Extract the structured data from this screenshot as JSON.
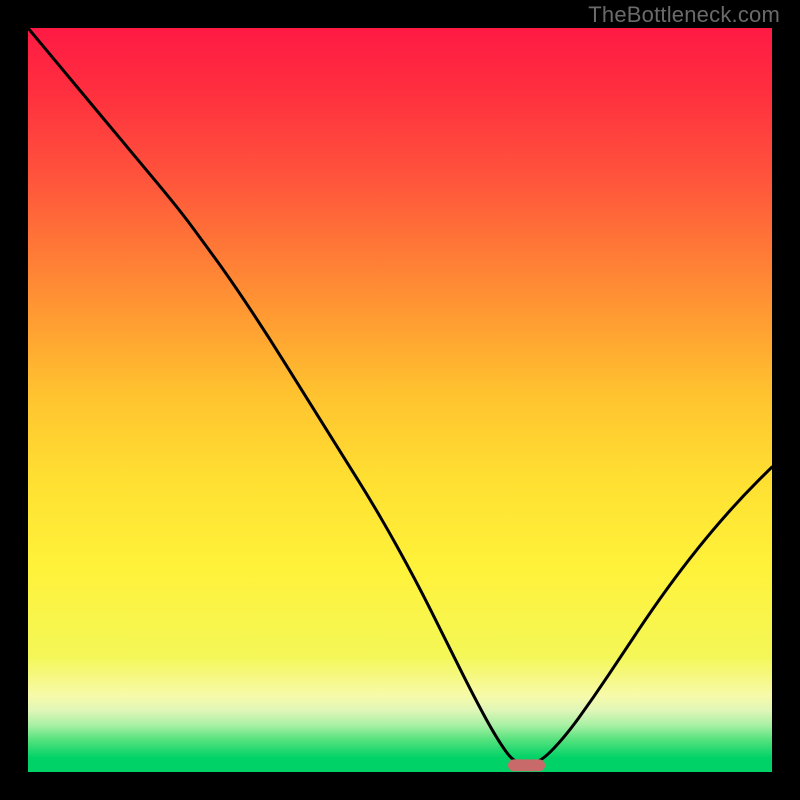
{
  "watermark": "TheBottleneck.com",
  "palette": {
    "black": "#000000",
    "desc": "vertical gradient red→orange→yellow→yellow-green→white-green→green with green floor",
    "stops": [
      {
        "offset": 0.0,
        "color": "#ff1a44"
      },
      {
        "offset": 0.08,
        "color": "#ff2d3f"
      },
      {
        "offset": 0.2,
        "color": "#ff523c"
      },
      {
        "offset": 0.35,
        "color": "#ff8a34"
      },
      {
        "offset": 0.5,
        "color": "#ffc22f"
      },
      {
        "offset": 0.62,
        "color": "#ffe032"
      },
      {
        "offset": 0.74,
        "color": "#fff23a"
      },
      {
        "offset": 0.86,
        "color": "#f4f757"
      },
      {
        "offset": 0.915,
        "color": "#f7faa9"
      },
      {
        "offset": 0.935,
        "color": "#dff6b8"
      },
      {
        "offset": 0.955,
        "color": "#a8f0a4"
      },
      {
        "offset": 0.975,
        "color": "#55e27d"
      },
      {
        "offset": 1.0,
        "color": "#00d267"
      }
    ],
    "floor_color": "#00d267",
    "curve_color": "#000000",
    "marker_fill": "#c96a6a"
  },
  "chart_data": {
    "type": "line",
    "title": "",
    "xlabel": "",
    "ylabel": "",
    "xlim": [
      0,
      100
    ],
    "ylim": [
      0,
      100
    ],
    "grid": false,
    "legend": false,
    "desc": "Bottleneck percentage curve. x ~ relative hardware balance parameter (0..100). y ~ bottleneck % (0 at optimum). Single deep V with minimum near x≈66; left arm starts at ~100% at x=0, right arm rises to ~40% at x=100. Optimum marker (pill) at the minimum.",
    "series": [
      {
        "name": "bottleneck-curve",
        "x": [
          0,
          5,
          10,
          15,
          20,
          23,
          27,
          32,
          37,
          42,
          47,
          52,
          56,
          60,
          63,
          65.5,
          68.5,
          72,
          76,
          80,
          84,
          88,
          92,
          96,
          100
        ],
        "y": [
          100,
          94,
          88,
          82,
          76,
          72,
          66.5,
          59,
          51,
          43,
          35,
          26,
          18,
          10,
          4.5,
          1.0,
          1.0,
          4.5,
          10,
          16,
          22,
          27.5,
          32.5,
          37,
          41
        ]
      }
    ],
    "marker": {
      "name": "optimum-marker",
      "x": 67.0,
      "y": 0.9,
      "w": 5.0,
      "h": 1.6
    }
  }
}
